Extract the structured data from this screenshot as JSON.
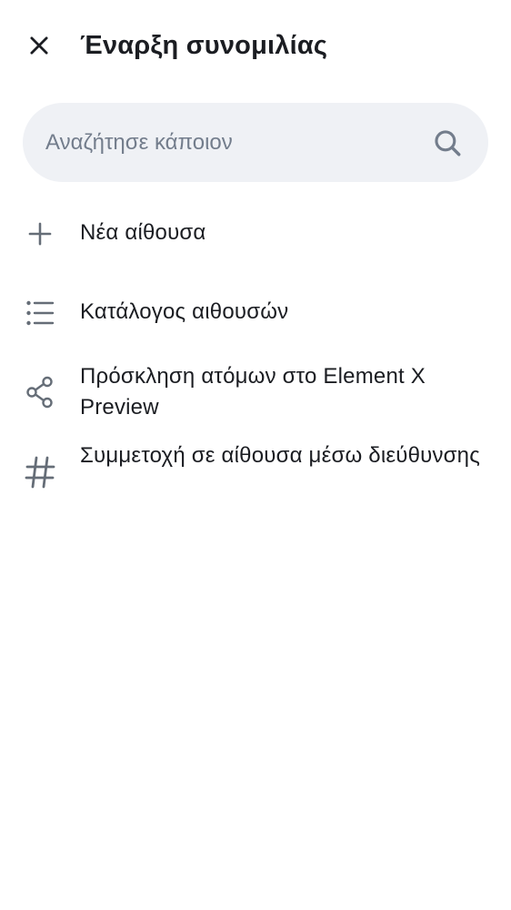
{
  "header": {
    "title": "Έναρξη συνομιλίας",
    "close_icon": "close-icon"
  },
  "search": {
    "placeholder": "Αναζήτησε κάποιον",
    "value": "",
    "icon": "search-icon"
  },
  "menu": {
    "items": [
      {
        "label": "Νέα αίθουσα",
        "icon": "plus-icon"
      },
      {
        "label": "Κατάλογος αιθουσών",
        "icon": "list-icon"
      },
      {
        "label": "Πρόσκληση ατόμων στο Element X Preview",
        "icon": "share-icon"
      },
      {
        "label": "Συμμετοχή σε αίθουσα μέσω διεύθυνσης",
        "icon": "hash-icon"
      }
    ]
  },
  "colors": {
    "text": "#1b1d22",
    "icon": "#656d77",
    "search_bg": "#eff1f5",
    "placeholder": "#737d8c"
  }
}
